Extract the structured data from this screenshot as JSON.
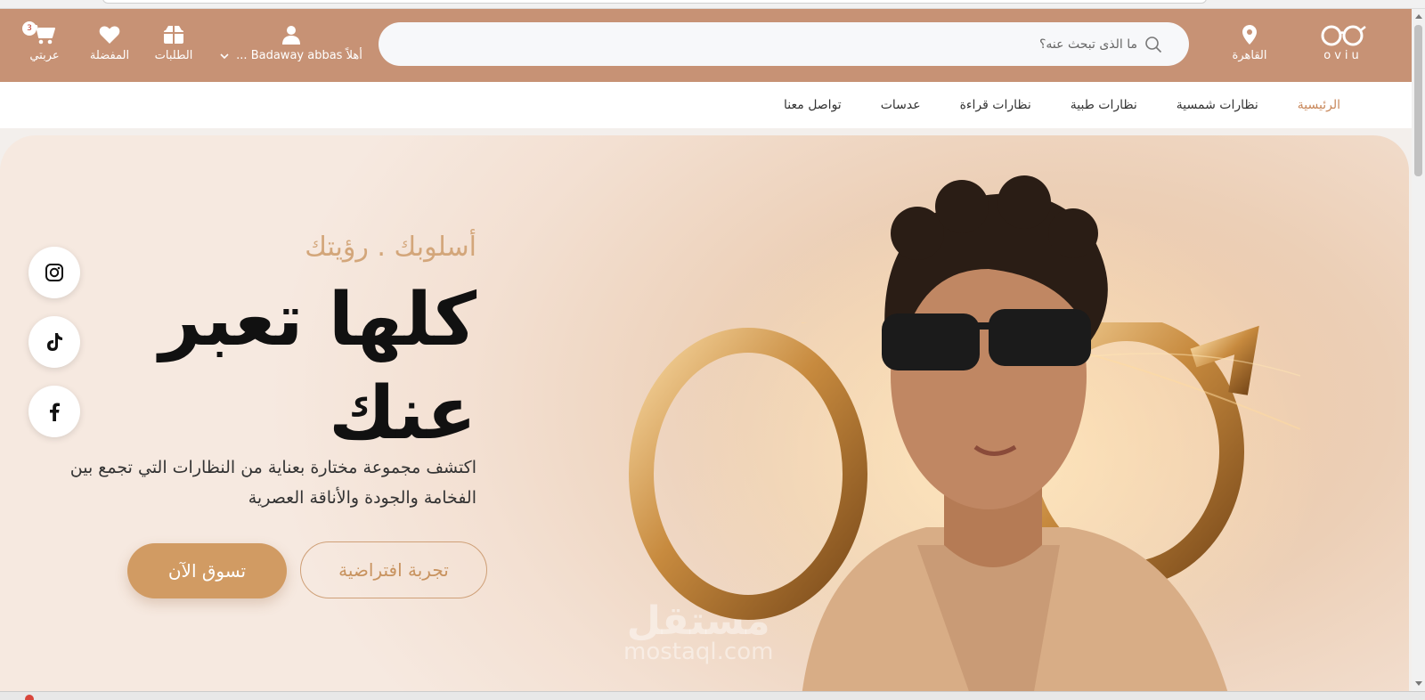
{
  "header": {
    "logo_text": "oviu",
    "location_label": "القاهرة",
    "search_placeholder": "ما الذى تبحث عنه؟",
    "user_label": "أهلاً Badaway abbas ...",
    "orders_label": "الطلبات",
    "favorites_label": "المفضلة",
    "cart_label": "عربتي",
    "cart_count": "3"
  },
  "nav": {
    "items": [
      {
        "label": "الرئيسية"
      },
      {
        "label": "نظارات شمسية"
      },
      {
        "label": "نظارات طبية"
      },
      {
        "label": "نظارات قراءة"
      },
      {
        "label": "عدسات"
      },
      {
        "label": "تواصل معنا"
      }
    ]
  },
  "hero": {
    "tagline": "أسلوبك . رؤيتك",
    "headline": "كلها تعبر عنك",
    "description": "اكتشف مجموعة مختارة بعناية من النظارات التي تجمع بين الفخامة والجودة والأناقة العصرية",
    "shop_button": "تسوق الآن",
    "virtual_try_button": "تجربة افتراضية"
  },
  "social": {
    "icons": [
      "instagram-icon",
      "tiktok-icon",
      "facebook-icon"
    ]
  },
  "watermark": {
    "arabic": "مستقل",
    "latin": "mostaql.com"
  },
  "colors": {
    "header_bg": "#c79275",
    "accent": "#d19b63",
    "nav_active": "#c8875a"
  }
}
